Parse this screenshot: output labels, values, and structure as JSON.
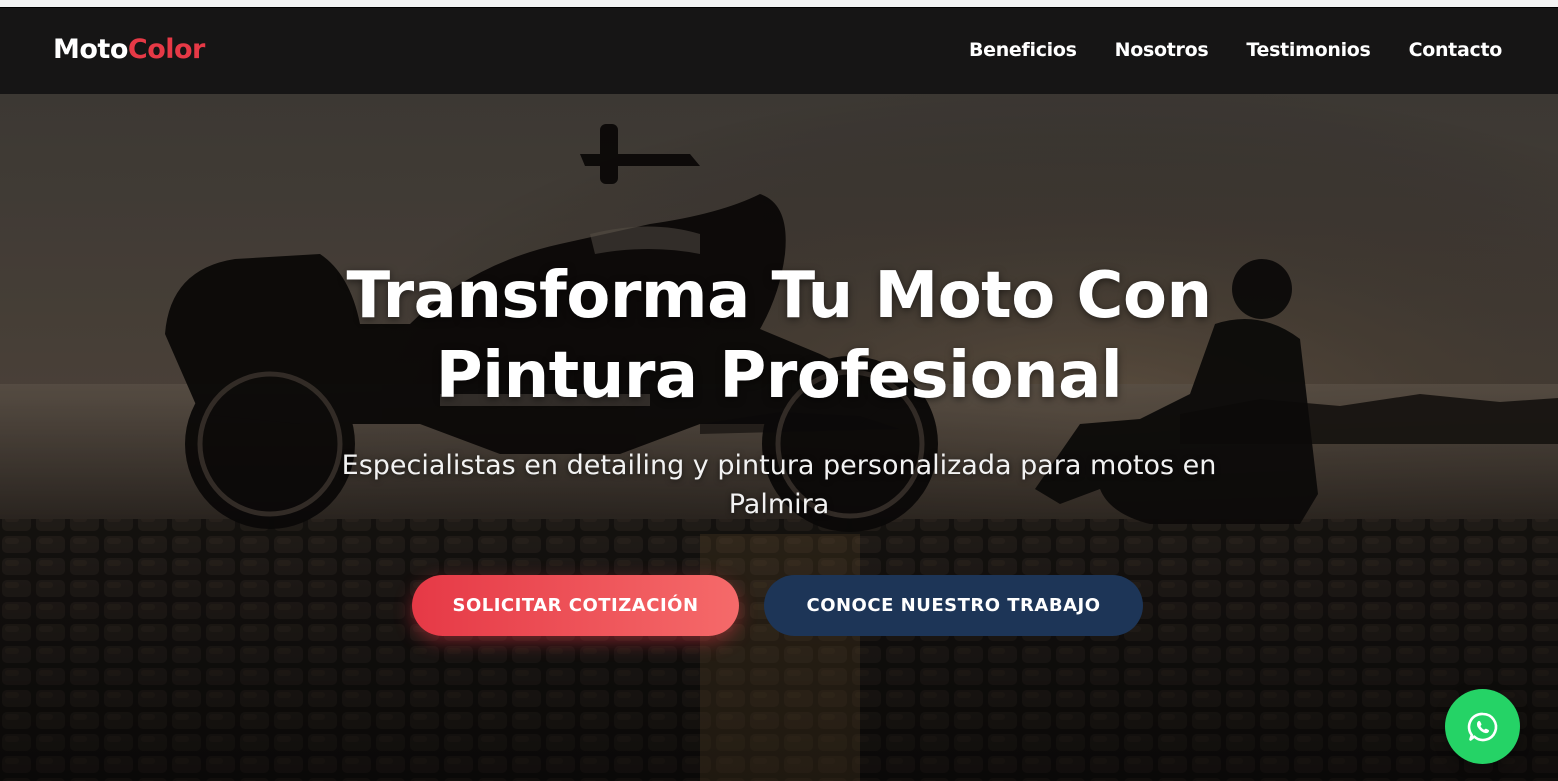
{
  "brand": {
    "name_part1": "Moto",
    "name_part2": "Color",
    "accent_color": "#e63946"
  },
  "nav": {
    "items": [
      {
        "label": "Beneficios"
      },
      {
        "label": "Nosotros"
      },
      {
        "label": "Testimonios"
      },
      {
        "label": "Contacto"
      }
    ]
  },
  "hero": {
    "title_line1": "Transforma Tu Moto Con",
    "title_line2": "Pintura Profesional",
    "subtitle": "Especialistas en detailing y pintura personalizada para motos en Palmira",
    "primary_button": "SOLICITAR COTIZACIÓN",
    "secondary_button": "CONOCE NUESTRO TRABAJO",
    "background_image": "motorcycle-at-sunset-photo",
    "primary_color": "#e63946",
    "secondary_color": "#1d3557"
  },
  "floating": {
    "whatsapp_icon": "whatsapp-icon",
    "whatsapp_color": "#25d366"
  }
}
